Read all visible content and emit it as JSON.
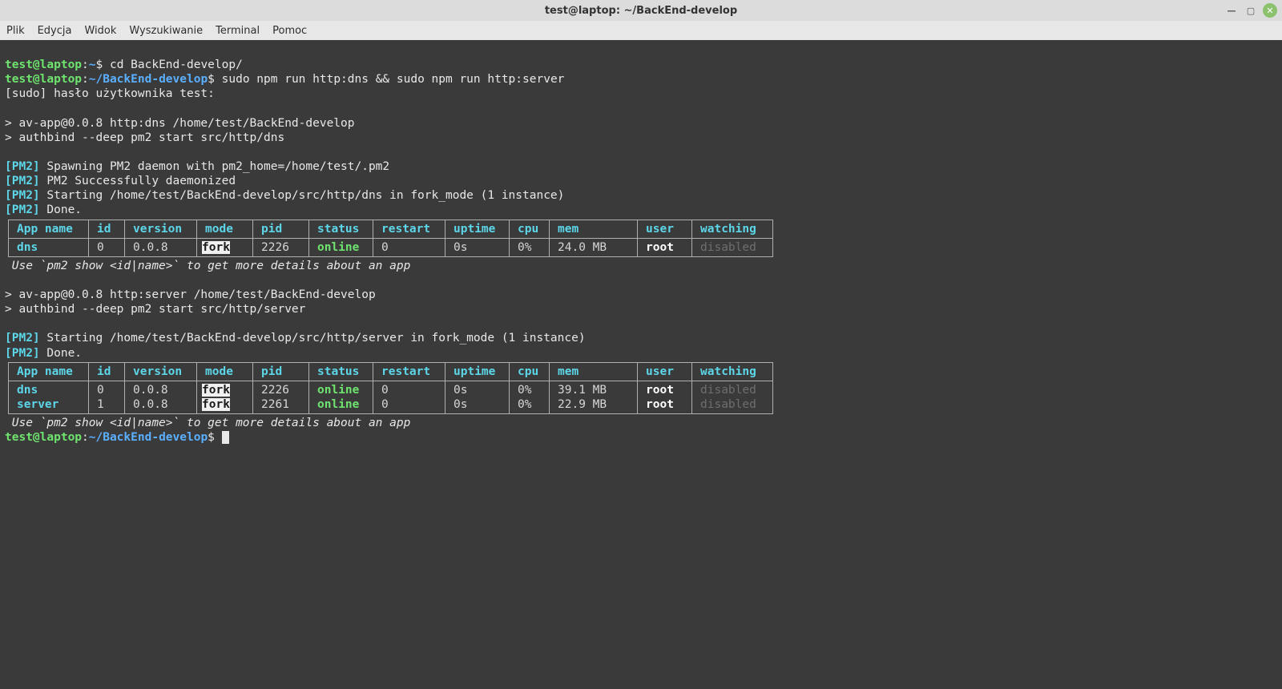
{
  "window": {
    "title": "test@laptop: ~/BackEnd-develop"
  },
  "menu": [
    "Plik",
    "Edycja",
    "Widok",
    "Wyszukiwanie",
    "Terminal",
    "Pomoc"
  ],
  "colors": {
    "bg_terminal": "#3a3a3a",
    "green": "#6ee46e",
    "cyan": "#5cd6e8",
    "blue": "#5aafff",
    "dim": "#6e6e6e"
  },
  "lines": {
    "l1_user": "test@laptop",
    "l1_path": "~",
    "l1_prompt": "$",
    "l1_cmd": "cd BackEnd-develop/",
    "l2_user": "test@laptop",
    "l2_path": "~/BackEnd-develop",
    "l2_prompt": "$",
    "l2_cmd": "sudo npm run http:dns && sudo npm run http:server",
    "l3": "[sudo] hasło użytkownika test:",
    "l4": "> av-app@0.0.8 http:dns /home/test/BackEnd-develop",
    "l5": "> authbind --deep pm2 start src/http/dns",
    "pm2_tag": "[PM2]",
    "pm2_1": " Spawning PM2 daemon with pm2_home=/home/test/.pm2",
    "pm2_2": " PM2 Successfully daemonized",
    "pm2_3": " Starting /home/test/BackEnd-develop/src/http/dns in fork_mode (1 instance)",
    "pm2_4": " Done.",
    "hint": " Use `pm2 show <id|name>` to get more details about an app",
    "mid1": "> av-app@0.0.8 http:server /home/test/BackEnd-develop",
    "mid2": "> authbind --deep pm2 start src/http/server",
    "pm2_5": " Starting /home/test/BackEnd-develop/src/http/server in fork_mode (1 instance)",
    "pm2_6": " Done.",
    "l_end_user": "test@laptop",
    "l_end_path": "~/BackEnd-develop",
    "l_end_prompt": "$"
  },
  "table1": {
    "headers": [
      "App name",
      "id",
      "version",
      "mode",
      "pid",
      "status",
      "restart",
      "uptime",
      "cpu",
      "mem",
      "user",
      "watching"
    ],
    "row": {
      "App name": "dns",
      "id": "0",
      "version": "0.0.8",
      "mode": "fork",
      "pid": "2226",
      "status": "online",
      "restart": "0",
      "uptime": "0s",
      "cpu": "0%",
      "mem": "24.0 MB",
      "user": "root",
      "watching": "disabled"
    }
  },
  "table2": {
    "headers": [
      "App name",
      "id",
      "version",
      "mode",
      "pid",
      "status",
      "restart",
      "uptime",
      "cpu",
      "mem",
      "user",
      "watching"
    ],
    "rows": [
      {
        "App name": "dns",
        "id": "0",
        "version": "0.0.8",
        "mode": "fork",
        "pid": "2226",
        "status": "online",
        "restart": "0",
        "uptime": "0s",
        "cpu": "0%",
        "mem": "39.1 MB",
        "user": "root",
        "watching": "disabled"
      },
      {
        "App name": "server",
        "id": "1",
        "version": "0.0.8",
        "mode": "fork",
        "pid": "2261",
        "status": "online",
        "restart": "0",
        "uptime": "0s",
        "cpu": "0%",
        "mem": "22.9 MB",
        "user": "root",
        "watching": "disabled"
      }
    ]
  }
}
